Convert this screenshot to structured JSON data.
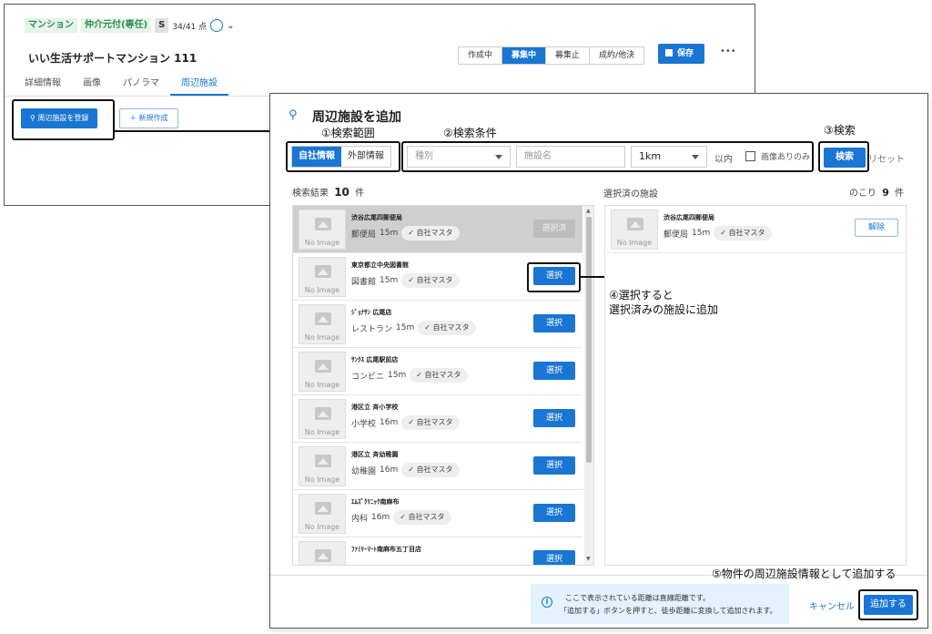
{
  "background_window": {
    "tags": [
      "マンション",
      "仲介元付(専任)"
    ],
    "grade": "S",
    "score": "34/41 点",
    "title": "いい生活サポートマンション 111",
    "status_buttons": [
      {
        "label": "作成中",
        "active": false
      },
      {
        "label": "募集中",
        "active": true
      },
      {
        "label": "募集止",
        "active": false
      },
      {
        "label": "成約/他決",
        "active": false
      }
    ],
    "save_label": "保存",
    "more_label": "•••",
    "tabs": [
      {
        "label": "詳細情報",
        "active": false
      },
      {
        "label": "画像",
        "active": false
      },
      {
        "label": "パノラマ",
        "active": false
      },
      {
        "label": "周辺施設",
        "active": true
      }
    ],
    "register_label": "周辺施設を登録",
    "new_label": "新規作成"
  },
  "annotations": {
    "a1": "①検索範囲",
    "a2": "②検索条件",
    "a3": "③検索",
    "a4_line1": "④選択すると",
    "a4_line2": "選択済みの施設に追加",
    "a5": "⑤物件の周辺施設情報として追加する"
  },
  "modal": {
    "title": "周辺施設を追加",
    "scope_tabs": [
      {
        "label": "自社情報",
        "active": true
      },
      {
        "label": "外部情報",
        "active": false
      }
    ],
    "category_placeholder": "種別",
    "name_placeholder": "施設名",
    "distance_value": "1km",
    "within_label": "以内",
    "image_only_label": "画像ありのみ",
    "search_label": "検索",
    "reset_label": "リセット",
    "results_label": "検索結果",
    "results_count": "10",
    "results_unit": "件",
    "selected_label": "選択済の施設",
    "remaining_label": "のこり",
    "remaining_count": "9",
    "remaining_unit": "件",
    "no_image": "No Image",
    "chip_label": "自社マスタ",
    "select_label": "選択",
    "selected_btn_label": "選択済",
    "unselect_label": "解除",
    "results": [
      {
        "name": "渋谷広尾四郵便局",
        "category": "郵便局",
        "distance": "15m",
        "selected": true
      },
      {
        "name": "東京都立中央図書館",
        "category": "図書館",
        "distance": "15m",
        "selected": false
      },
      {
        "name": "ｼﾞｮﾅｻﾝ 広尾店",
        "category": "レストラン",
        "distance": "15m",
        "selected": false
      },
      {
        "name": "ｻﾝｸｽ 広尾駅前店",
        "category": "コンビニ",
        "distance": "15m",
        "selected": false
      },
      {
        "name": "港区立 斉小学校",
        "category": "小学校",
        "distance": "16m",
        "selected": false
      },
      {
        "name": "港区立 斉幼稚園",
        "category": "幼稚園",
        "distance": "16m",
        "selected": false
      },
      {
        "name": "ｴﾑｽﾞｸﾘﾆｯｸ南麻布",
        "category": "内科",
        "distance": "16m",
        "selected": false
      },
      {
        "name": "ﾌｧﾐﾘｰﾏｰﾄ南麻布五丁目店",
        "category": "",
        "distance": "",
        "selected": false
      }
    ],
    "selected_items": [
      {
        "name": "渋谷広尾四郵便局",
        "category": "郵便局",
        "distance": "15m"
      }
    ],
    "info_line1": "ここで表示されている距離は直線距離です。",
    "info_line2": "「追加する」ボタンを押すと、徒歩距離に変換して追加されます。",
    "cancel_label": "キャンセル",
    "add_label": "追加する"
  }
}
